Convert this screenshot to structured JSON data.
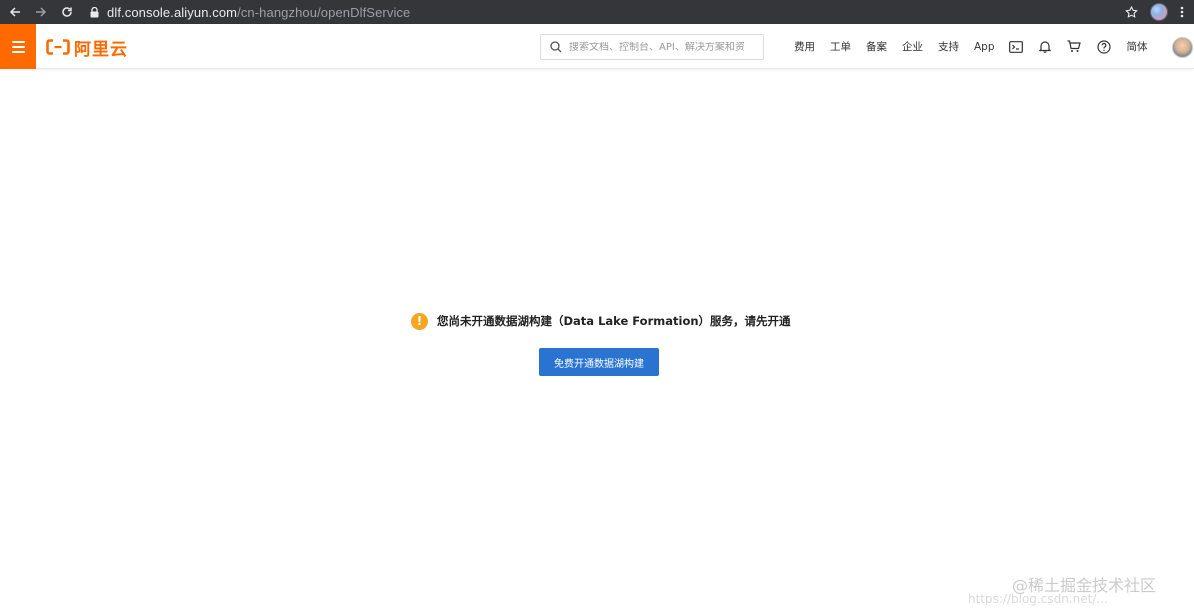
{
  "browser": {
    "url_host": "dlf.console.aliyun.com",
    "url_path": "/cn-hangzhou/openDlfService",
    "icons": [
      "back-icon",
      "forward-icon",
      "reload-icon",
      "lock-icon",
      "star-icon",
      "profile-avatar",
      "more-icon"
    ]
  },
  "header": {
    "logo_text": "阿里云",
    "brand_color": "#ff6a00",
    "search_placeholder": "搜索文档、控制台、API、解决方案和资",
    "nav": {
      "fee": "费用",
      "ticket": "工单",
      "filing": "备案",
      "enterprise": "企业",
      "support": "支持",
      "app": "App",
      "lang": "简体"
    },
    "icons": [
      "menu-icon",
      "search-icon",
      "terminal-icon",
      "bell-icon",
      "cart-icon",
      "help-icon",
      "user-avatar"
    ]
  },
  "main": {
    "notice_text": "您尚未开通数据湖构建（Data Lake Formation）服务，请先开通",
    "warning_symbol": "!",
    "warning_color": "#f5a623",
    "activate_button": "免费开通数据湖构建",
    "button_color": "#2a74d1"
  },
  "watermark": {
    "text": "@稀土掘金技术社区",
    "url": "https://blog.csdn.net/..."
  }
}
